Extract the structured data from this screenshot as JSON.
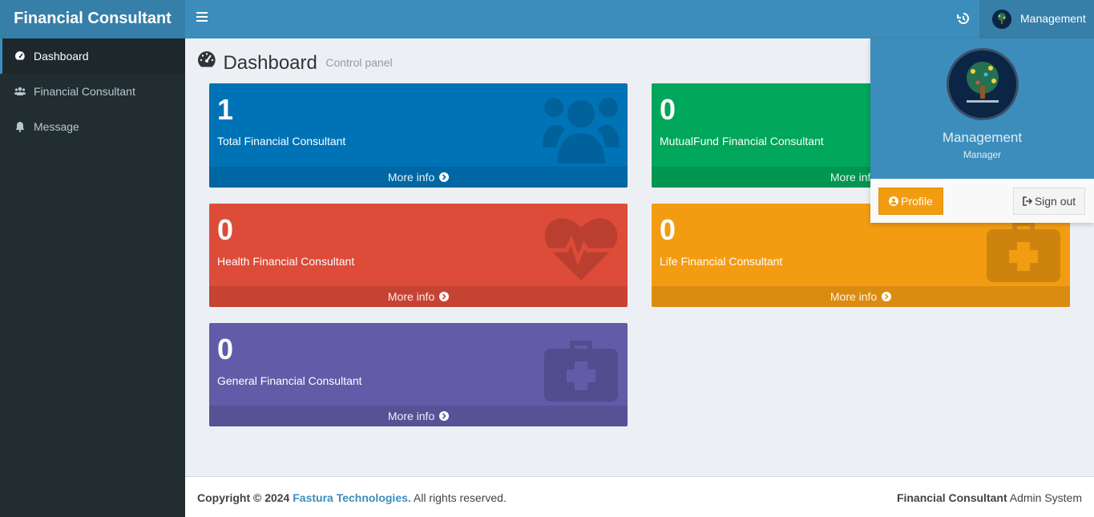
{
  "header": {
    "logo": "Financial Consultant",
    "user_name": "Management"
  },
  "sidebar": {
    "items": [
      {
        "label": "Dashboard",
        "icon": "dashboard-icon"
      },
      {
        "label": "Financial Consultant",
        "icon": "users-icon"
      },
      {
        "label": "Message",
        "icon": "bell-icon"
      }
    ]
  },
  "content": {
    "title": "Dashboard",
    "subtitle": "Control panel"
  },
  "boxes": [
    {
      "count": "1",
      "label": "Total Financial Consultant",
      "more": "More info",
      "color": "#0073b7",
      "icon": "users-icon"
    },
    {
      "count": "0",
      "label": "MutualFund Financial Consultant",
      "more": "More info",
      "color": "#00a65a",
      "icon": "chart-icon"
    },
    {
      "count": "0",
      "label": "Health Financial Consultant",
      "more": "More info",
      "color": "#dd4b39",
      "icon": "heartbeat-icon"
    },
    {
      "count": "0",
      "label": "Life Financial Consultant",
      "more": "More info",
      "color": "#f39c12",
      "icon": "medkit-icon"
    },
    {
      "count": "0",
      "label": "General Financial Consultant",
      "more": "More info",
      "color": "#605ca8",
      "icon": "medkit-icon"
    }
  ],
  "dropdown": {
    "name": "Management",
    "role": "Manager",
    "profile_label": "Profile",
    "signout_label": "Sign out"
  },
  "footer": {
    "copyright_prefix": "Copyright © 2024",
    "company": "Fastura Technologies.",
    "rights": "All rights reserved.",
    "system_bold": "Financial Consultant",
    "system_rest": "Admin System"
  }
}
